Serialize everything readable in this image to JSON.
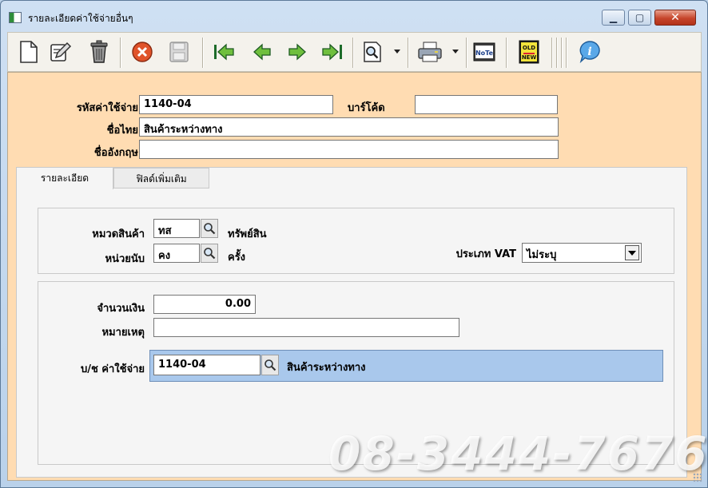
{
  "window": {
    "title": "รายละเอียดค่าใช้จ่ายอื่นๆ",
    "min_label": "▁",
    "max_label": "▢",
    "close_label": "✕"
  },
  "toolbar": {
    "buttons": [
      {
        "name": "new-icon"
      },
      {
        "name": "edit-icon"
      },
      {
        "name": "delete-trash-icon"
      },
      {
        "name": "cancel-icon"
      },
      {
        "name": "save-disk-icon"
      },
      {
        "name": "first-record-icon"
      },
      {
        "name": "previous-record-icon"
      },
      {
        "name": "next-record-icon"
      },
      {
        "name": "last-record-icon"
      },
      {
        "name": "search-icon"
      },
      {
        "name": "print-icon"
      },
      {
        "name": "note-icon"
      },
      {
        "name": "old-new-icon"
      },
      {
        "name": "info-icon"
      }
    ],
    "note_text": "NoTe",
    "oldnew_top": "OLD",
    "oldnew_bottom": "NEW",
    "info_text": "i"
  },
  "header": {
    "code_label": "รหัสค่าใช้จ่าย",
    "code_value": "1140-04",
    "barcode_label": "บาร์โค้ด",
    "barcode_value": "",
    "thai_name_label": "ชื่อไทย",
    "thai_name_value": "สินค้าระหว่างทาง",
    "eng_name_label": "ชื่ออังกฤษ",
    "eng_name_value": ""
  },
  "tabs": [
    {
      "label": "รายละเอียด",
      "active": true
    },
    {
      "label": "ฟิลด์เพิ่มเติม",
      "active": false
    }
  ],
  "details": {
    "category_label": "หมวดสินค้า",
    "category_code": "ทส",
    "category_name": "ทรัพย์สิน",
    "unit_label": "หน่วยนับ",
    "unit_code": "คง",
    "unit_name": "ครั้ง",
    "vat_label": "ประเภท VAT",
    "vat_value": "ไม่ระบุ",
    "amount_label": "จำนวนเงิน",
    "amount_value": "0.00",
    "note_label": "หมายเหตุ",
    "note_value": "",
    "account_label": "บ/ช ค่าใช้จ่าย",
    "account_code": "1140-04",
    "account_name": "สินค้าระหว่างทาง"
  },
  "watermark": "08-3444-7676",
  "colors": {
    "content_bg": "#ffdcb2",
    "account_row_bg": "#a9c8ec",
    "close_button": "#c6452b"
  }
}
